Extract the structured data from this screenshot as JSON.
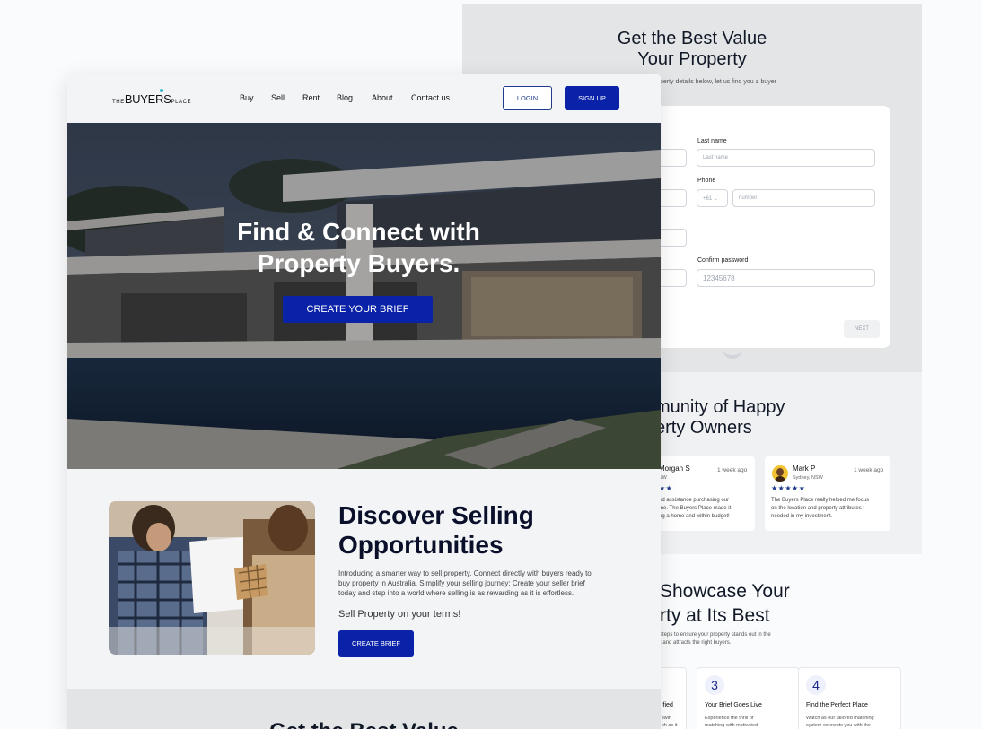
{
  "back": {
    "form_title_line1": "Get the Best Value",
    "form_title_line2": "Your Property",
    "form_subtitle": "perty details below, let us find you a buyer",
    "last_name_label": "Last name",
    "last_name_placeholder": "Last name",
    "phone_label": "Phone",
    "phone_code": "+61",
    "phone_placeholder": "number",
    "confirm_password_label": "Confirm password",
    "confirm_password_value": "12345678",
    "next_label": "NEXT",
    "community_title_line1": "munity of Happy",
    "community_title_line2": "erty Owners",
    "reviews": [
      {
        "name": "Morgan S",
        "location": "SW",
        "time": "1 week ago",
        "stars": "★★",
        "text_lines": [
          "ed assistance purchasing our",
          "me. The Buyers Place made it",
          "ng a home and within budget!"
        ]
      },
      {
        "name": "Mark P",
        "location": "Sydney, NSW",
        "time": "1 week ago",
        "stars": "★★★★★",
        "text_lines": [
          "The Buyers Place really helped me focus",
          "on the location and property attributes I",
          "needed in my investment."
        ]
      }
    ],
    "showcase_title_line1": "Showcase Your",
    "showcase_title_line2": "rty at Its Best",
    "showcase_sub_line1": "steps to ensure your property stands out in the",
    "showcase_sub_line2": "t and attracts the right buyers.",
    "steps": [
      {
        "title": "ified",
        "text_lines": [
          "swift",
          "ch as it"
        ]
      },
      {
        "num": "3",
        "title": "Your Brief Goes Live",
        "text_lines": [
          "Experience the thrill of",
          "matching with motivated"
        ]
      },
      {
        "num": "4",
        "title": "Find the Perfect Place",
        "text_lines": [
          "Watch as our tailored matching",
          "system connects you with the"
        ]
      }
    ]
  },
  "front": {
    "logo": {
      "the": "THE",
      "buyers": "BUYERS",
      "place": "PLACE"
    },
    "nav": [
      "Buy",
      "Sell",
      "Rent",
      "Blog",
      "About",
      "Contact us"
    ],
    "login_label": "LOGIN",
    "signup_label": "SIGN UP",
    "hero_line1": "Find & Connect with",
    "hero_line2": "Property Buyers.",
    "hero_cta": "CREATE YOUR BRIEF",
    "disc_title_line1": "Discover Selling",
    "disc_title_line2": "Opportunities",
    "disc_text_lines": [
      "Introducing a smarter way to sell property. Connect directly with buyers ready to",
      "buy property in Australia. Simplify your selling journey: Create your seller brief",
      "today and step into a world where selling is as rewarding as it is effortless."
    ],
    "disc_tagline": "Sell Property on your terms!",
    "disc_cta": "CREATE  BRIEF",
    "bottom_title": "Get the Best Value"
  },
  "colors": {
    "primary": "#0a22a8",
    "stars": "#1e3a8a",
    "accent_dot": "#2bb5c8"
  }
}
